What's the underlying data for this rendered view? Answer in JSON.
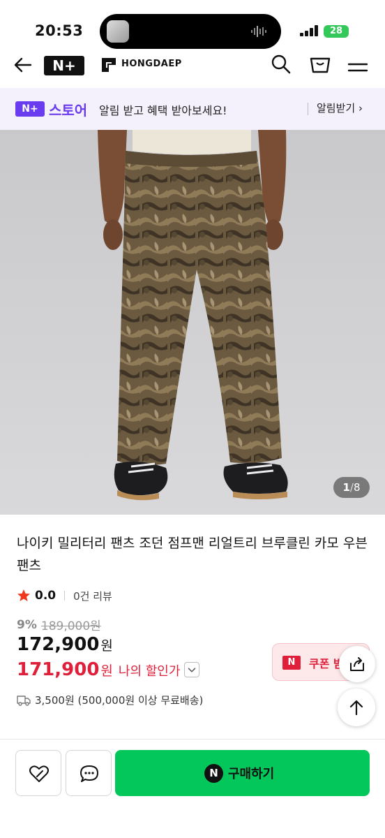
{
  "status_bar": {
    "time": "20:53",
    "battery": "28"
  },
  "header": {
    "np_logo": "N+",
    "brand": "HONGDAEP"
  },
  "store_banner": {
    "badge": "N+",
    "name": "스토어",
    "message": "알림 받고 혜택 받아보세요!",
    "notify_label": "알림받기 ›"
  },
  "image": {
    "current": "1",
    "separator": "/",
    "total": "8"
  },
  "product": {
    "title": "나이키 밀리터리 팬츠 조던 점프맨 리얼트리 브루클린 카모 우븐 팬츠",
    "rating": "0.0",
    "reviews": "0건 리뷰",
    "discount_rate": "9%",
    "original_price": "189,000원",
    "price": "172,900",
    "price_unit": "원",
    "my_price": "171,900",
    "my_price_unit": "원",
    "my_price_label": "나의 할인가"
  },
  "coupon": {
    "badge": "N",
    "label": "쿠폰 받"
  },
  "shipping": "3,500원 (500,000원 이상 무료배송)",
  "bottom": {
    "buy_badge": "N",
    "buy_label": "구매하기"
  },
  "colors": {
    "accent_purple": "#6a3cf0",
    "sale_red": "#e0203a",
    "buy_green": "#03c75a"
  }
}
